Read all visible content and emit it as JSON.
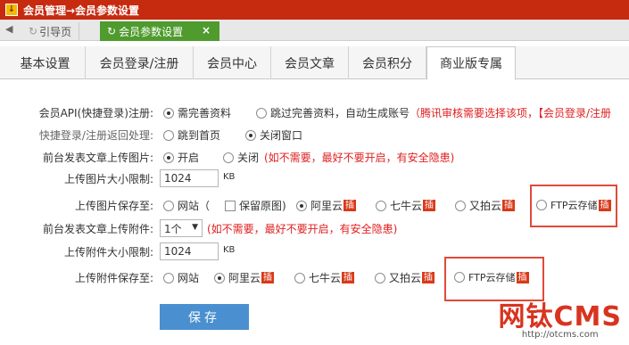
{
  "window": {
    "title": "会员管理→会员参数设置"
  },
  "nav": {
    "tab1": "引导页",
    "tab2": "会员参数设置",
    "close": "×"
  },
  "tabs": [
    "基本设置",
    "会员登录/注册",
    "会员中心",
    "会员文章",
    "会员积分",
    "商业版专属"
  ],
  "form": {
    "api_label": "会员API(快捷登录)注册:",
    "api_opt1": "需完善资料",
    "api_opt2": "跳过完善资料，自动生成账号",
    "api_note": "（腾讯审核需要选择该项，【会员登录/注册",
    "return_label": "快捷登录/注册返回处理:",
    "return_opt1": "跳到首页",
    "return_opt2": "关闭窗口",
    "upimg_label": "前台发表文章上传图片:",
    "upimg_on": "开启",
    "upimg_off": "关闭",
    "upimg_note": "(如不需要，最好不要开启，有安全隐患)",
    "imgsize_label": "上传图片大小限制:",
    "imgsize_value": "1024",
    "imgsize_unit": "KB",
    "imgsave_label": "上传图片保存至:",
    "imgsave_site": "网站（",
    "imgsave_keep": "保留原图)",
    "imgsave_aliyun": "阿里云",
    "imgsave_qiniu": "七牛云",
    "imgsave_upyun": "又拍云",
    "imgsave_ftp": "FTP云存储",
    "plugin_badge": "插",
    "upfile_label": "前台发表文章上传附件:",
    "upfile_value": "1个",
    "upfile_note": "(如不需要，最好不要开启，有安全隐患)",
    "filesize_label": "上传附件大小限制:",
    "filesize_value": "1024",
    "filesize_unit": "KB",
    "filesave_label": "上传附件保存至:",
    "filesave_site": "网站",
    "filesave_aliyun": "阿里云",
    "filesave_qiniu": "七牛云",
    "filesave_upyun": "又拍云",
    "filesave_ftp": "FTP云存储",
    "save_button": "保存"
  },
  "watermark": {
    "brand": "网钛CMS",
    "url": "http://otcms.com"
  }
}
